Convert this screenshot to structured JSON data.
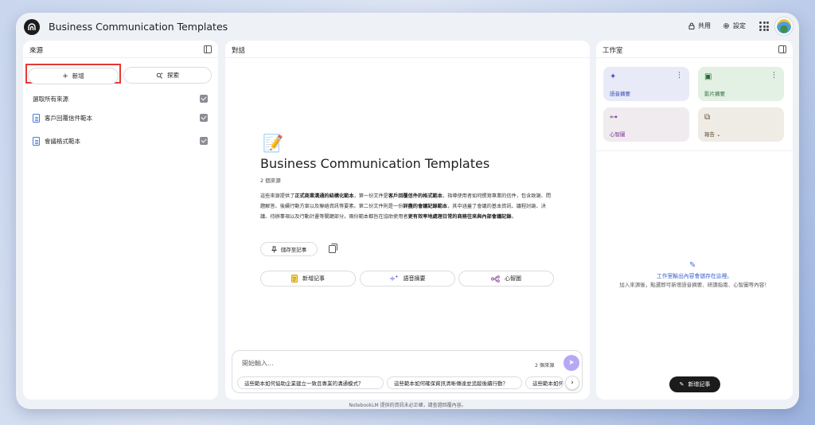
{
  "app": {
    "title": "Business Communication Templates"
  },
  "header": {
    "share_label": "共用",
    "settings_label": "設定"
  },
  "sources": {
    "title": "來源",
    "add_label": "新增",
    "discover_label": "探索",
    "select_all_label": "選取所有來源",
    "items": [
      {
        "label": "客戶回覆信件範本",
        "checked": true
      },
      {
        "label": "會議格式範本",
        "checked": true
      }
    ]
  },
  "chat": {
    "title": "對話",
    "notebook_title": "Business Communication Templates",
    "source_count": "2 個來源",
    "summary_parts": [
      {
        "t": "這些來源提供了",
        "b": false
      },
      {
        "t": "正式商業溝通的結構化範本",
        "b": true
      },
      {
        "t": "，第一份文件是",
        "b": false
      },
      {
        "t": "客戶回覆信件的格式範本",
        "b": true
      },
      {
        "t": "，指導使用者如何撰寫專業的信件，包含致謝、問題解答、後續行動方案以及聯絡資訊等要素。第二份文件則是一份",
        "b": false
      },
      {
        "t": "詳盡的會議記錄範本",
        "b": true
      },
      {
        "t": "，其中涵蓋了會議的基本資訊、議程討論、決議、待辦事項以及行動計畫等關鍵部分。兩份範本都旨在協助使用者",
        "b": false
      },
      {
        "t": "更有效率地處理日常的商務往來與內部會議記錄",
        "b": true
      },
      {
        "t": "。",
        "b": false
      }
    ],
    "save_note_label": "儲存至記事",
    "chips": [
      "新增記事",
      "語音摘要",
      "心智圖"
    ],
    "input_placeholder": "開始輸入...",
    "input_source_count": "2 個來源",
    "suggestions": [
      "這些範本如何協助企業建立一致且專業的溝通模式？",
      "這些範本如何確保資訊清晰傳達並追蹤後續行動？",
      "這些範本如何"
    ]
  },
  "studio": {
    "title": "工作室",
    "cards": [
      {
        "label": "語音摘要",
        "color": "#e8eaf8"
      },
      {
        "label": "影片摘要",
        "color": "#e2f1e4"
      },
      {
        "label": "心智圖",
        "color": "#efebef"
      },
      {
        "label": "報告",
        "color": "#efece6"
      }
    ],
    "empty_title": "工作室輸出內容會儲存在這裡。",
    "empty_desc": "加入來源後，點選即可新增語音摘要、研讀指南、心智圖等內容！",
    "new_note_label": "新增記事"
  },
  "footer": {
    "note": "NotebookLM 提供的資訊未必正確，請查證回覆內容。"
  }
}
